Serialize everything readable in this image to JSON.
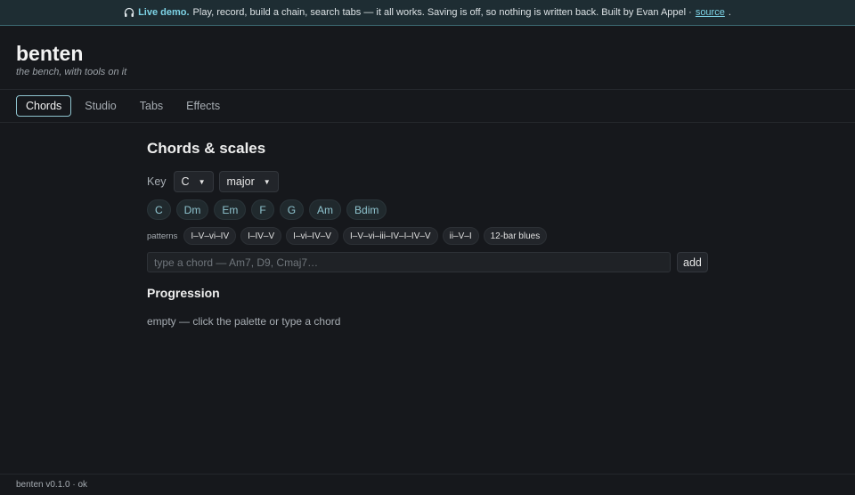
{
  "banner": {
    "icon": "headphones-icon",
    "live_label": "Live demo.",
    "message": "Play, record, build a chain, search tabs — it all works. Saving is off, so nothing is written back. Built by Evan Appel ·",
    "source_link": "source",
    "trailing": ".",
    "accent": "#7dd3e6"
  },
  "header": {
    "title": "benten",
    "subtitle": "the bench, with tools on it"
  },
  "tabs": [
    {
      "label": "Chords",
      "active": true
    },
    {
      "label": "Studio",
      "active": false
    },
    {
      "label": "Tabs",
      "active": false
    },
    {
      "label": "Effects",
      "active": false
    }
  ],
  "main": {
    "heading": "Chords & scales",
    "key_label": "Key",
    "key_value": "C",
    "mode_value": "major",
    "palette": [
      "C",
      "Dm",
      "Em",
      "F",
      "G",
      "Am",
      "Bdim"
    ],
    "patterns_label": "patterns",
    "patterns": [
      "I–V–vi–IV",
      "I–IV–V",
      "I–vi–IV–V",
      "I–V–vi–iii–IV–I–IV–V",
      "ii–V–I",
      "12-bar blues"
    ],
    "chord_input_placeholder": "type a chord — Am7, D9, Cmaj7…",
    "add_label": "add",
    "progression_heading": "Progression",
    "empty_message": "empty — click the palette or type a chord"
  },
  "footer": {
    "status": "benten v0.1.0 · ok"
  }
}
